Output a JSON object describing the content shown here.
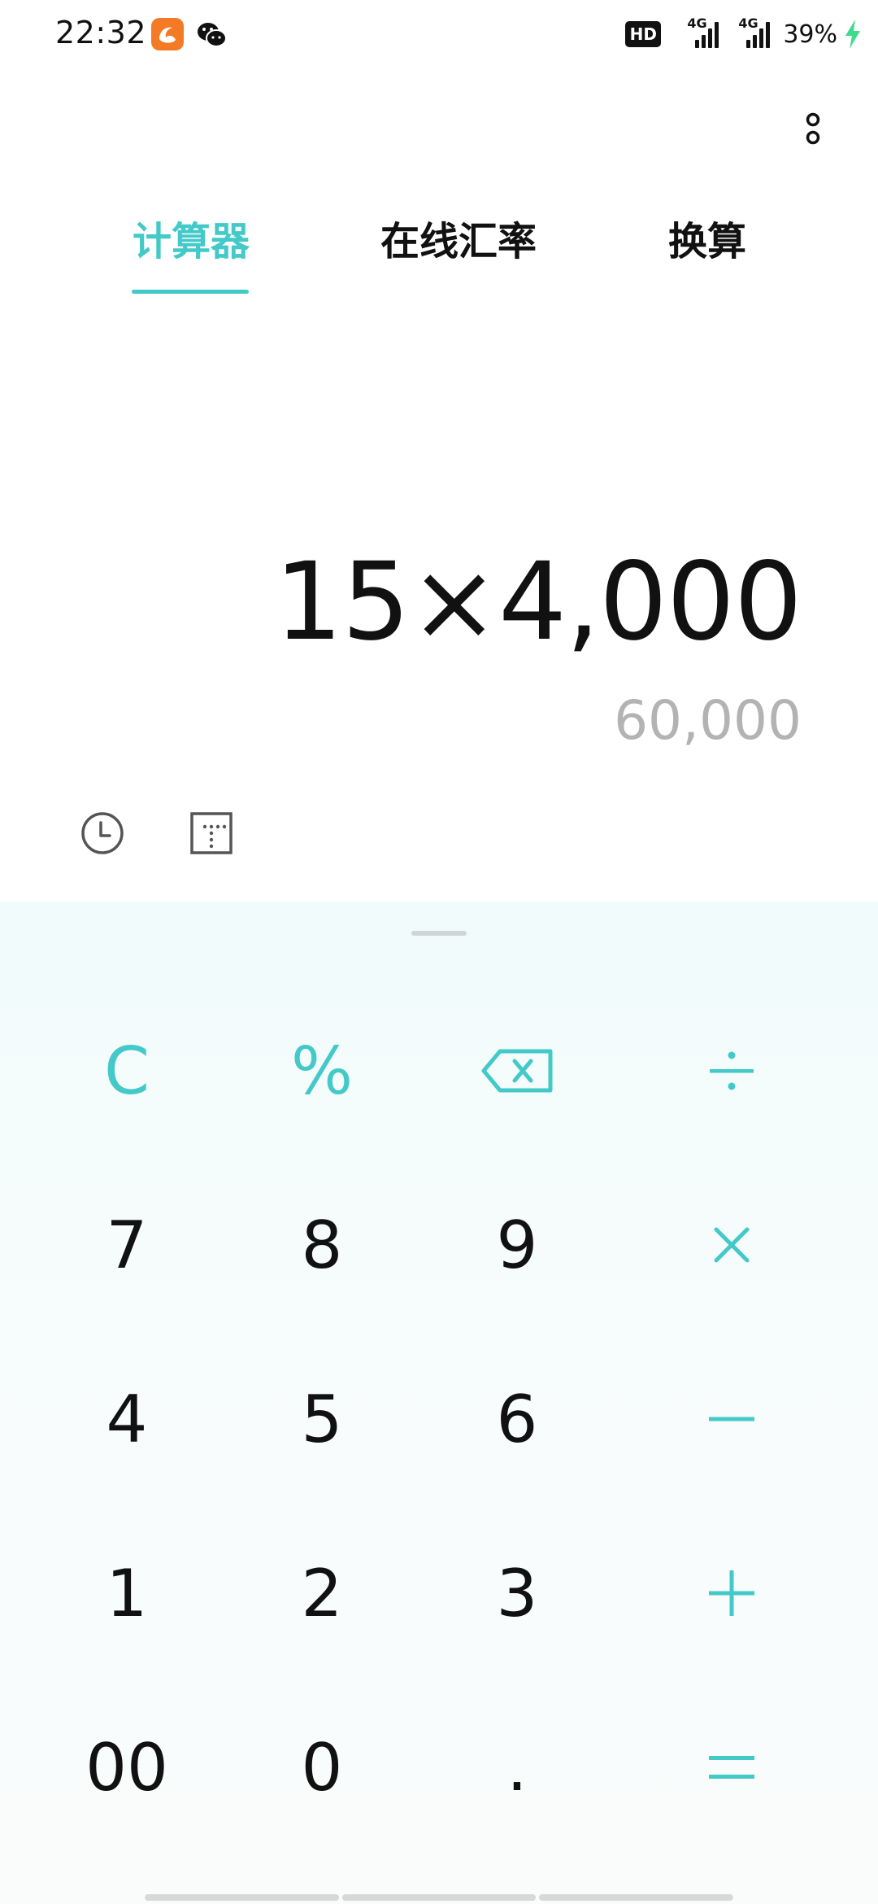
{
  "status_bar": {
    "time": "22:32",
    "hd_badge": "HD",
    "network_1": "4G",
    "network_2": "4G",
    "battery": "39%",
    "icons": [
      "uc-browser-icon",
      "wechat-icon",
      "charging-bolt-icon"
    ]
  },
  "tabs": [
    {
      "label": "计算器",
      "active": true
    },
    {
      "label": "在线汇率",
      "active": false
    },
    {
      "label": "换算",
      "active": false
    }
  ],
  "display": {
    "expression": "15×4,000",
    "result": "60,000"
  },
  "toolbar": {
    "icons": [
      "history-icon",
      "scientific-mode-icon"
    ]
  },
  "keypad": {
    "rows": [
      [
        "C",
        "%",
        "⌫",
        "÷"
      ],
      [
        "7",
        "8",
        "9",
        "×"
      ],
      [
        "4",
        "5",
        "6",
        "−"
      ],
      [
        "1",
        "2",
        "3",
        "+"
      ],
      [
        "00",
        "0",
        ".",
        "="
      ]
    ]
  },
  "colors": {
    "accent": "#44C9C9",
    "text": "#111111",
    "result_text": "#B3B3B3",
    "keypad_bg": "#F4FBFB"
  }
}
